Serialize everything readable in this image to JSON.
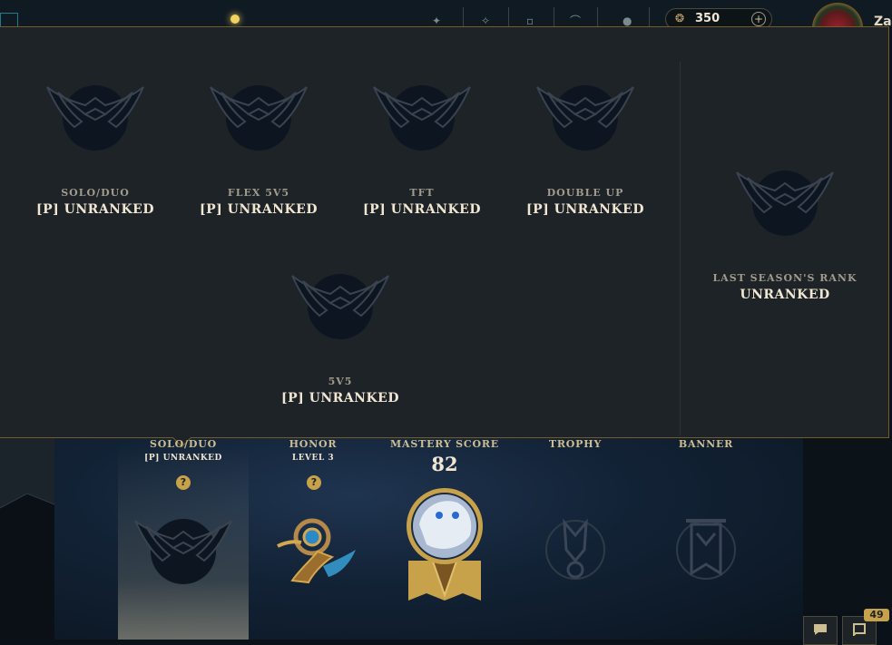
{
  "topbar": {
    "currency_value": "350",
    "currency_icon": "rp-coin-icon",
    "profile_name": "Za"
  },
  "ranked_popup": {
    "queues": [
      {
        "queue": "SOLO/DUO",
        "rank": "[P] UNRANKED"
      },
      {
        "queue": "FLEX 5V5",
        "rank": "[P] UNRANKED"
      },
      {
        "queue": "TFT",
        "rank": "[P] UNRANKED"
      },
      {
        "queue": "DOUBLE UP",
        "rank": "[P] UNRANKED"
      },
      {
        "queue": "5V5",
        "rank": "[P] UNRANKED"
      }
    ],
    "last_season": {
      "label": "LAST SEASON'S RANK",
      "rank": "UNRANKED"
    }
  },
  "profile_strip": {
    "solo_duo": {
      "label": "SOLO/DUO",
      "value": "[P] UNRANKED"
    },
    "honor": {
      "label": "HONOR",
      "value": "LEVEL 3"
    },
    "mastery": {
      "label": "MASTERY SCORE",
      "value": "82"
    },
    "trophy": {
      "label": "TROPHY"
    },
    "banner": {
      "label": "BANNER"
    }
  },
  "bottom_right": {
    "badge_count": "49"
  },
  "colors": {
    "gold": "#c8aa6e",
    "panel_bg": "#1e2328",
    "panel_border": "#785a28",
    "text_light": "#f0e6d2",
    "text_muted": "#a09b8c"
  }
}
